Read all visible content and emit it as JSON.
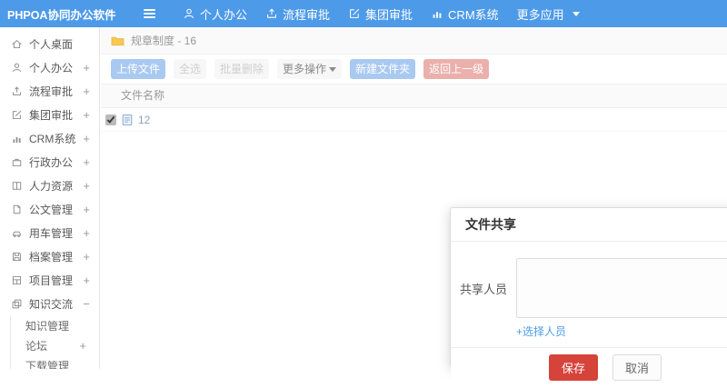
{
  "app": {
    "title": "PHPOA协同办公软件"
  },
  "topbar": {
    "nav": [
      {
        "label": "个人办公",
        "icon": "user-icon"
      },
      {
        "label": "流程审批",
        "icon": "flow-icon"
      },
      {
        "label": "集团审批",
        "icon": "edit-icon"
      },
      {
        "label": "CRM系统",
        "icon": "chart-icon"
      },
      {
        "label": "更多应用",
        "icon": "caret-down-icon"
      }
    ]
  },
  "sidebar": {
    "items": [
      {
        "label": "个人桌面",
        "expand": ""
      },
      {
        "label": "个人办公",
        "expand": "+"
      },
      {
        "label": "流程审批",
        "expand": "+"
      },
      {
        "label": "集团审批",
        "expand": "+"
      },
      {
        "label": "CRM系统",
        "expand": "+"
      },
      {
        "label": "行政办公",
        "expand": "+"
      },
      {
        "label": "人力资源",
        "expand": "+"
      },
      {
        "label": "公文管理",
        "expand": "+"
      },
      {
        "label": "用车管理",
        "expand": "+"
      },
      {
        "label": "档案管理",
        "expand": "+"
      },
      {
        "label": "项目管理",
        "expand": "+"
      },
      {
        "label": "知识交流",
        "expand": "−"
      }
    ],
    "subitems": [
      {
        "label": "知识管理",
        "expand": ""
      },
      {
        "label": "论坛",
        "expand": "+"
      },
      {
        "label": "下载管理",
        "expand": ""
      }
    ]
  },
  "breadcrumb": {
    "label": "规章制度 - 16"
  },
  "toolbar": {
    "buttons": [
      {
        "label": "上传文件",
        "style": "primary"
      },
      {
        "label": "全选",
        "style": "muted"
      },
      {
        "label": "批量删除",
        "style": "muted"
      },
      {
        "label": "更多操作",
        "style": "default",
        "caret": true
      },
      {
        "label": "新建文件夹",
        "style": "primary"
      },
      {
        "label": "返回上一级",
        "style": "danger"
      }
    ]
  },
  "table": {
    "header": "文件名称",
    "rows": [
      {
        "name": "12",
        "checked": true,
        "checked_attr": "checked"
      }
    ]
  },
  "modal": {
    "title": "文件共享",
    "share_label": "共享人员",
    "textarea_value": "",
    "select_link": "+选择人员",
    "save_label": "保存",
    "cancel_label": "取消"
  },
  "colors": {
    "topbar_blue": "#4D9AE8",
    "primary_pale": "#A9C9F1",
    "danger_pale": "#EBB0AC",
    "save_red": "#D5433B",
    "link_blue": "#4D9BE9",
    "folder_yellow": "#F8C851"
  }
}
